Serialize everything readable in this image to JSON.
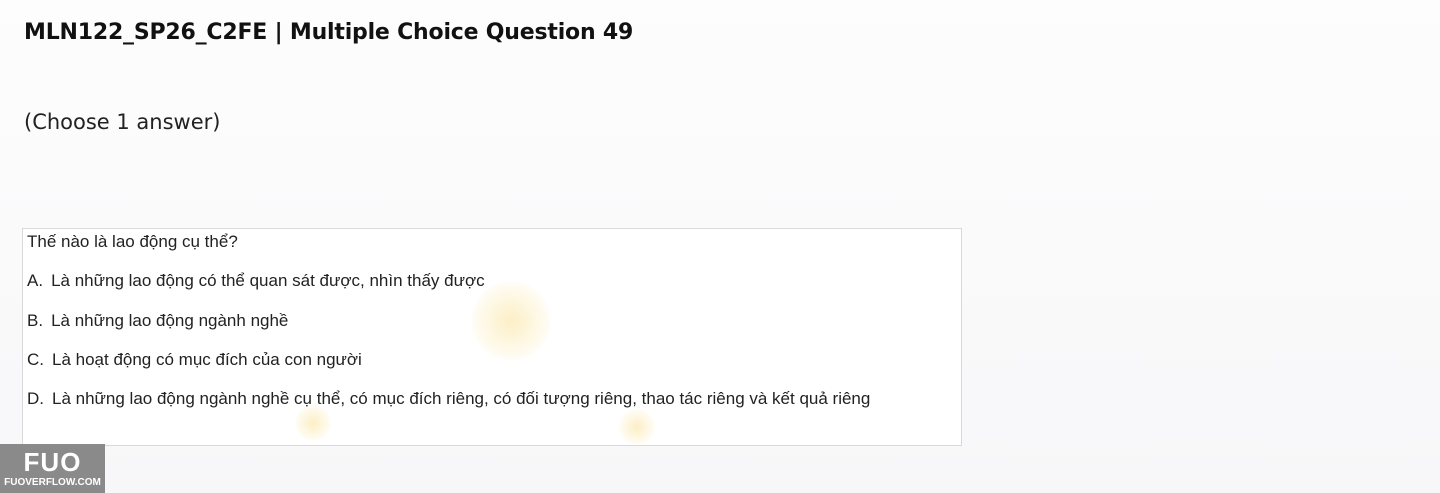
{
  "header": {
    "title": "MLN122_SP26_C2FE | Multiple Choice Question 49",
    "instruction": "(Choose 1 answer)"
  },
  "question": {
    "text": "Thế nào là lao động cụ thể?",
    "options": [
      {
        "letter": "A.",
        "text": "Là những lao động có thể quan sát được, nhìn thấy được"
      },
      {
        "letter": "B.",
        "text": "Là những lao động ngành nghề"
      },
      {
        "letter": "C.",
        "text": "Là hoạt động có mục đích của con người"
      },
      {
        "letter": "D.",
        "text": "Là những lao động ngành nghề cụ thể, có mục đích riêng, có đối tượng riêng, thao tác riêng và kết quả riêng"
      }
    ]
  },
  "watermark": {
    "logo_mark": "FUO",
    "logo_site": "FUOVERFLOW.COM"
  }
}
